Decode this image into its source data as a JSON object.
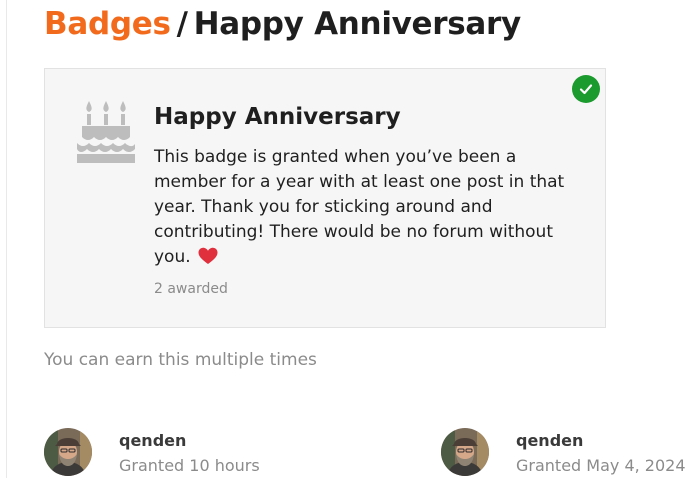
{
  "breadcrumb": {
    "root": "Badges",
    "separator": "/",
    "current": "Happy Anniversary"
  },
  "badge": {
    "icon": "birthday-cake-icon",
    "title": "Happy Anniversary",
    "description": "This badge is granted when you’ve been a member for a year with at least one post in that year. Thank you for sticking around and contributing! There would be no forum without you.",
    "description_emoji": "heart-icon",
    "awarded": "2 awarded",
    "earned_icon": "check-icon"
  },
  "multiple_note": "You can earn this multiple times",
  "grants": [
    {
      "username": "qenden",
      "granted": "Granted 10 hours"
    },
    {
      "username": "qenden",
      "granted": "Granted May 4, 2024"
    }
  ],
  "colors": {
    "brand": "#f26b1d",
    "success": "#1b9a2e",
    "heart": "#e0303d",
    "icon_gray": "#bdbdbd",
    "muted_text": "#8b8b8b"
  }
}
